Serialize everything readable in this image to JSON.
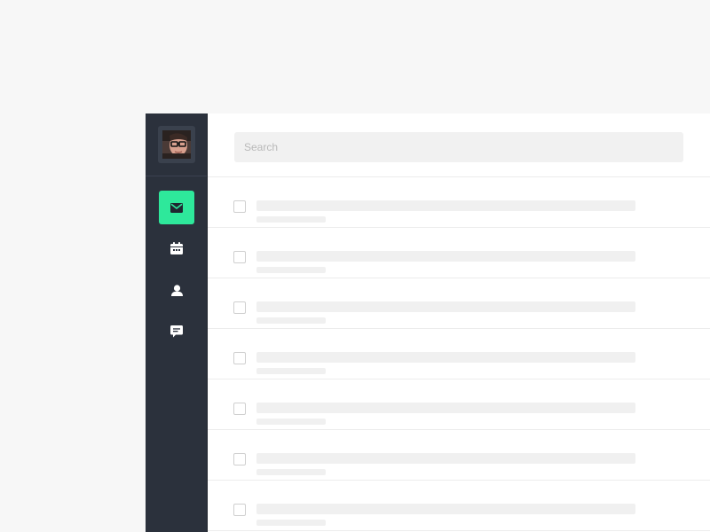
{
  "search": {
    "placeholder": "Search",
    "value": ""
  },
  "sidebar": {
    "avatar": "user-avatar",
    "items": [
      {
        "name": "mail",
        "icon": "mail-icon",
        "active": true
      },
      {
        "name": "calendar",
        "icon": "calendar-icon",
        "active": false
      },
      {
        "name": "contacts",
        "icon": "person-icon",
        "active": false
      },
      {
        "name": "chat",
        "icon": "chat-icon",
        "active": false
      }
    ]
  },
  "colors": {
    "sidebar_bg": "#2b313c",
    "accent": "#2ee89b",
    "page_bg": "#f7f7f7",
    "placeholder_bar": "#f0f0f0"
  },
  "messages": [
    {
      "state": "loading"
    },
    {
      "state": "loading"
    },
    {
      "state": "loading"
    },
    {
      "state": "loading"
    },
    {
      "state": "loading"
    },
    {
      "state": "loading"
    },
    {
      "state": "loading"
    }
  ]
}
